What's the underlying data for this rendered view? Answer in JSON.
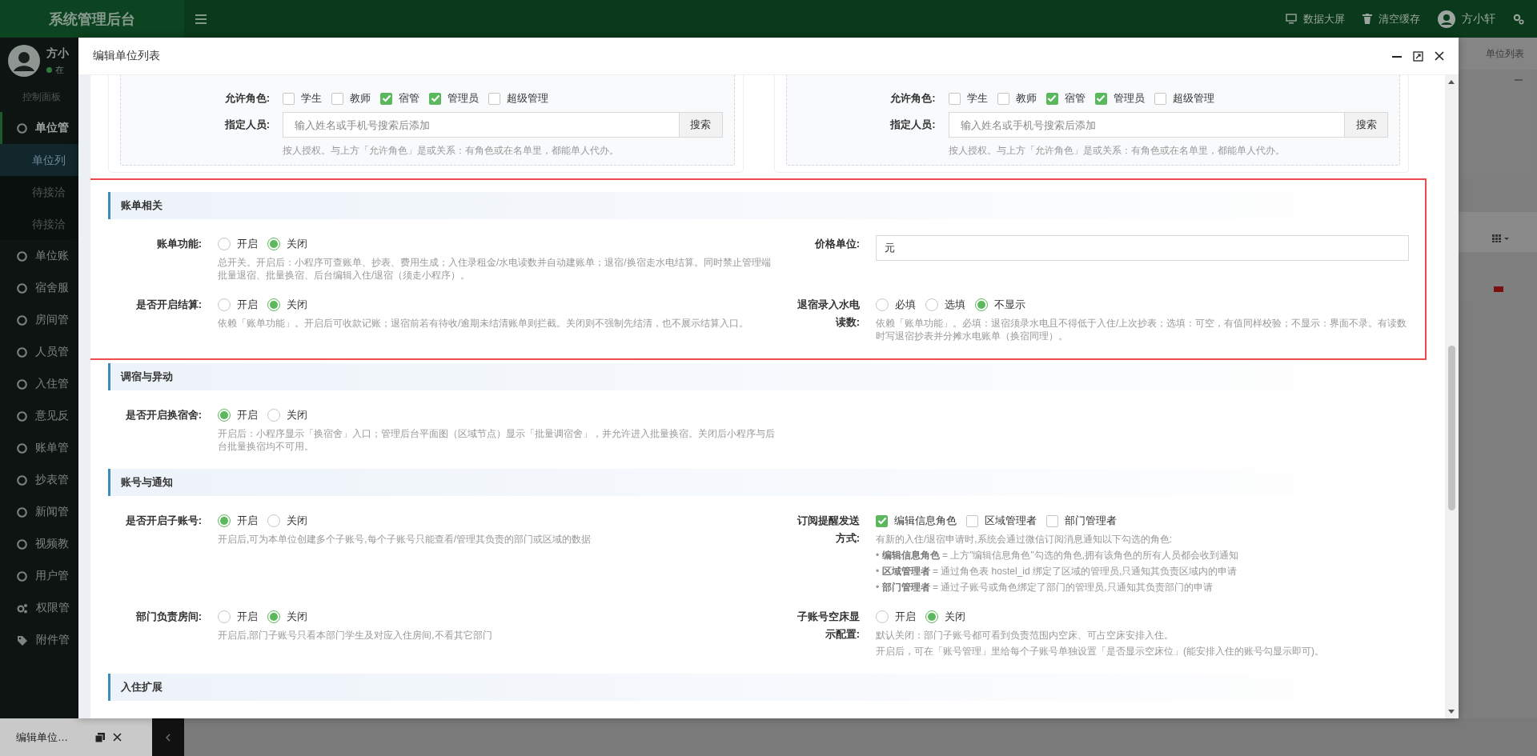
{
  "app": {
    "title": "系统管理后台"
  },
  "header_actions": [
    {
      "kind": "monitor",
      "label": "数据大屏"
    },
    {
      "kind": "trash",
      "label": "清空缓存"
    }
  ],
  "user": {
    "name": "方小轩"
  },
  "sidebar": {
    "user_name": "方小",
    "status": "在",
    "section_label": "控制面板",
    "items": [
      {
        "label": "单位管",
        "kind": "circle",
        "expanded": true,
        "children": [
          {
            "label": "单位列",
            "selected": true
          },
          {
            "label": "待接洽",
            "selected": false
          },
          {
            "label": "待接洽",
            "selected": false
          }
        ]
      },
      {
        "label": "单位账",
        "kind": "circle",
        "expanded": false
      },
      {
        "label": "宿舍服",
        "kind": "circle",
        "expanded": false
      },
      {
        "label": "房间管",
        "kind": "circle",
        "expanded": false
      },
      {
        "label": "人员管",
        "kind": "circle",
        "expanded": false
      },
      {
        "label": "入住管",
        "kind": "circle",
        "expanded": false
      },
      {
        "label": "意见反",
        "kind": "circle",
        "expanded": false
      },
      {
        "label": "账单管",
        "kind": "circle",
        "expanded": false
      },
      {
        "label": "抄表管",
        "kind": "circle",
        "expanded": false
      },
      {
        "label": "新闻管",
        "kind": "circle",
        "expanded": false
      },
      {
        "label": "视频教",
        "kind": "circle",
        "expanded": false
      },
      {
        "label": "用户管",
        "kind": "circle",
        "expanded": false
      },
      {
        "label": "权限管",
        "kind": "gears",
        "expanded": false
      },
      {
        "label": "附件管",
        "kind": "tag",
        "expanded": false
      }
    ]
  },
  "page_tab": {
    "label": "单位列表"
  },
  "taskbar": {
    "label": "编辑单位…"
  },
  "modal": {
    "title": "编辑单位列表",
    "cards": [
      {
        "roles_label": "允许角色:",
        "roles": [
          {
            "label": "学生",
            "checked": false
          },
          {
            "label": "教师",
            "checked": false
          },
          {
            "label": "宿管",
            "checked": true
          },
          {
            "label": "管理员",
            "checked": true
          },
          {
            "label": "超级管理",
            "checked": false
          }
        ],
        "person_label": "指定人员:",
        "placeholder": "输入姓名或手机号搜索后添加",
        "button": "搜索",
        "hint": "按人授权。与上方「允许角色」是或关系：有角色或在名单里，都能单人代办。"
      },
      {
        "roles_label": "允许角色:",
        "roles": [
          {
            "label": "学生",
            "checked": false
          },
          {
            "label": "教师",
            "checked": false
          },
          {
            "label": "宿管",
            "checked": true
          },
          {
            "label": "管理员",
            "checked": true
          },
          {
            "label": "超级管理",
            "checked": false
          }
        ],
        "person_label": "指定人员:",
        "placeholder": "输入姓名或手机号搜索后添加",
        "button": "搜索",
        "hint": "按人授权。与上方「允许角色」是或关系：有角色或在名单里，都能单人代办。"
      }
    ],
    "sections": [
      {
        "title": "账单相关",
        "highlighted": true,
        "rows": [
          {
            "left": {
              "kind": "radio",
              "label": "账单功能:",
              "options": [
                {
                  "label": "开启",
                  "selected": false
                },
                {
                  "label": "关闭",
                  "selected": true
                }
              ],
              "hints": [
                "总开关。开启后：小程序可查账单、抄表、费用生成；入住录租金/水电读数并自动建账单；退宿/换宿走水电结算。同时禁止管理端批量退宿、批量换宿、后台编辑入住/退宿（须走小程序）。"
              ]
            },
            "right": {
              "kind": "text",
              "label": "价格单位:",
              "value": "元"
            }
          },
          {
            "left": {
              "kind": "radio",
              "label": "是否开启结算:",
              "options": [
                {
                  "label": "开启",
                  "selected": false
                },
                {
                  "label": "关闭",
                  "selected": true
                }
              ],
              "hints": [
                "依赖「账单功能」。开启后可收款记账；退宿前若有待收/逾期未结清账单则拦截。关闭则不强制先结清，也不展示结算入口。"
              ]
            },
            "right": {
              "kind": "radio",
              "label": "退宿录入水电读数:",
              "options": [
                {
                  "label": "必填",
                  "selected": false
                },
                {
                  "label": "选填",
                  "selected": false
                },
                {
                  "label": "不显示",
                  "selected": true
                }
              ],
              "hints": [
                "依赖「账单功能」。必填：退宿须录水电且不得低于入住/上次抄表；选填：可空，有值同样校验；不显示：界面不录。有读数时写退宿抄表并分摊水电账单（换宿同理）。"
              ]
            }
          }
        ]
      },
      {
        "title": "调宿与异动",
        "highlighted": false,
        "rows": [
          {
            "left": {
              "kind": "radio",
              "label": "是否开启换宿舍:",
              "options": [
                {
                  "label": "开启",
                  "selected": true
                },
                {
                  "label": "关闭",
                  "selected": false
                }
              ],
              "hints": [
                "开启后：小程序显示「换宿舍」入口；管理后台平面图（区域节点）显示「批量调宿舍」，并允许进入批量换宿。关闭后小程序与后台批量换宿均不可用。"
              ]
            }
          }
        ]
      },
      {
        "title": "账号与通知",
        "highlighted": false,
        "rows": [
          {
            "left": {
              "kind": "radio",
              "label": "是否开启子账号:",
              "options": [
                {
                  "label": "开启",
                  "selected": true
                },
                {
                  "label": "关闭",
                  "selected": false
                }
              ],
              "hints": [
                "开启后,可为本单位创建多个子账号,每个子账号只能查看/管理其负责的部门或区域的数据"
              ]
            },
            "right": {
              "kind": "checkbox",
              "label": "订阅提醒发送方式:",
              "options": [
                {
                  "label": "编辑信息角色",
                  "checked": true
                },
                {
                  "label": "区域管理者",
                  "checked": false
                },
                {
                  "label": "部门管理者",
                  "checked": false
                }
              ],
              "hints": [
                "有新的入住/退宿申请时,系统会通过微信订阅消息通知以下勾选的角色:",
                "• **编辑信息角色** = 上方\"编辑信息角色\"勾选的角色,拥有该角色的所有人员都会收到通知",
                "• **区域管理者** = 通过角色表 hostel_id 绑定了区域的管理员,只通知其负责区域内的申请",
                "• **部门管理者** = 通过子账号或角色绑定了部门的管理员,只通知其负责部门的申请"
              ]
            }
          },
          {
            "left": {
              "kind": "radio",
              "label": "部门负责房间:",
              "options": [
                {
                  "label": "开启",
                  "selected": false
                },
                {
                  "label": "关闭",
                  "selected": true
                }
              ],
              "hints": [
                "开启后,部门子账号只看本部门学生及对应入住房间,不看其它部门"
              ]
            },
            "right": {
              "kind": "radio",
              "label": "子账号空床显示配置:",
              "options": [
                {
                  "label": "开启",
                  "selected": false
                },
                {
                  "label": "关闭",
                  "selected": true
                }
              ],
              "hints": [
                "默认关闭：部门子账号都可看到负责范围内空床、可占空床安排入住。",
                "开启后，可在「账号管理」里给每个子账号单独设置「是否显示空床位」(能安排入住的账号勾显示即可)。"
              ]
            }
          }
        ]
      },
      {
        "title": "入住扩展",
        "highlighted": false
      }
    ]
  }
}
